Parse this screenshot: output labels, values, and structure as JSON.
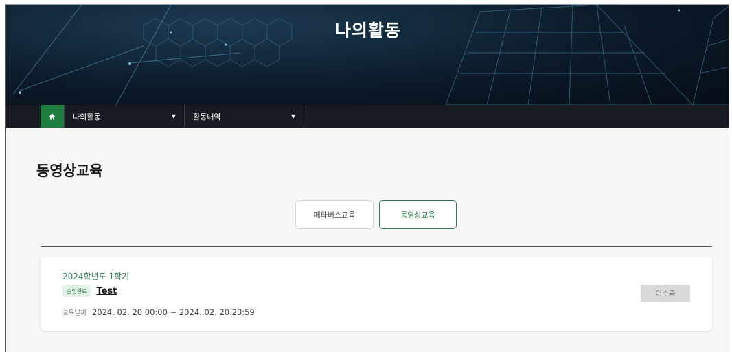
{
  "hero": {
    "title": "나의활동"
  },
  "nav": {
    "home_icon": "home-icon",
    "menu1": {
      "label": "나의활동",
      "icon": "caret-down-icon"
    },
    "menu2": {
      "label": "활동내역",
      "icon": "caret-down-icon"
    }
  },
  "page": {
    "title": "동영상교육"
  },
  "tabs": [
    {
      "label": "메타버스교육",
      "active": false
    },
    {
      "label": "동영상교육",
      "active": true
    }
  ],
  "course": {
    "semester": "2024학년도 1학기",
    "badge": "승인완료",
    "title": "Test",
    "date_label": "교육날짜",
    "date_range": "2024. 02. 20 00:00 ~ 2024. 02. 20 23:59",
    "status": "이수중"
  },
  "colors": {
    "accent_green": "#2e7d4f",
    "home_green": "#1e7c3f",
    "hero_dark": "#0c1b2a"
  }
}
